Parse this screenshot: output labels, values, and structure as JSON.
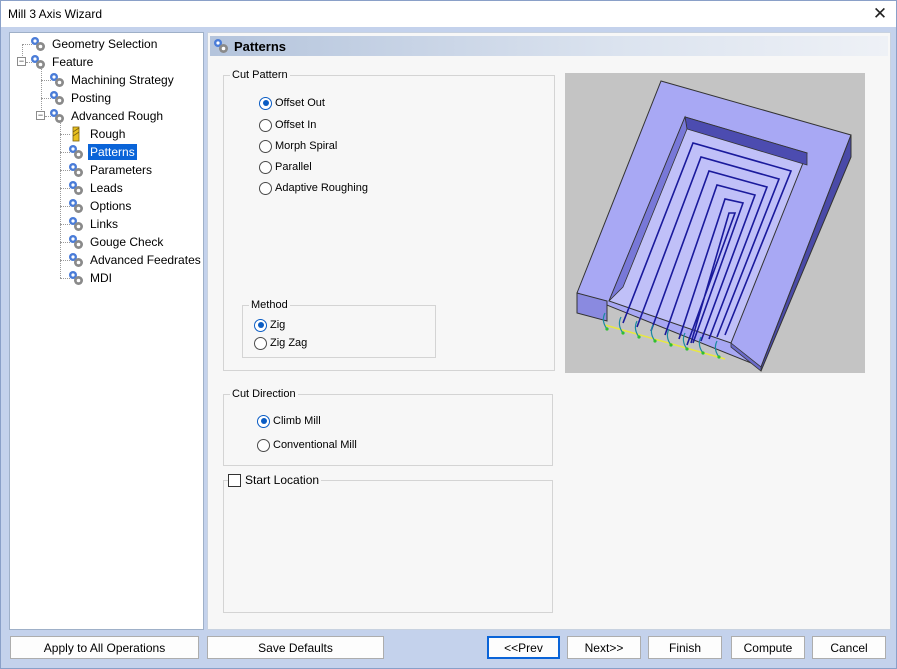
{
  "window": {
    "title": "Mill 3 Axis Wizard"
  },
  "tree": {
    "items": [
      {
        "label": "Geometry Selection",
        "icon": "gear-group-icon"
      },
      {
        "label": "Feature",
        "icon": "gear-group-icon"
      },
      {
        "label": "Machining Strategy",
        "icon": "gear-group-icon"
      },
      {
        "label": "Posting",
        "icon": "gear-group-icon"
      },
      {
        "label": "Advanced Rough",
        "icon": "gear-group-icon"
      },
      {
        "label": "Rough",
        "icon": "tool-icon"
      },
      {
        "label": "Patterns",
        "icon": "gear-group-icon",
        "selected": true
      },
      {
        "label": "Parameters",
        "icon": "gear-group-icon"
      },
      {
        "label": "Leads",
        "icon": "gear-group-icon"
      },
      {
        "label": "Options",
        "icon": "gear-group-icon"
      },
      {
        "label": "Links",
        "icon": "gear-group-icon"
      },
      {
        "label": "Gouge Check",
        "icon": "gear-group-icon"
      },
      {
        "label": "Advanced Feedrates",
        "icon": "gear-group-icon"
      },
      {
        "label": "MDI",
        "icon": "gear-group-icon"
      }
    ]
  },
  "panel": {
    "title": "Patterns",
    "cut_pattern": {
      "label": "Cut Pattern",
      "options": [
        "Offset Out",
        "Offset In",
        "Morph Spiral",
        "Parallel",
        "Adaptive Roughing"
      ],
      "selected": "Offset Out"
    },
    "method": {
      "label": "Method",
      "options": [
        "Zig",
        "Zig Zag"
      ],
      "selected": "Zig"
    },
    "cut_direction": {
      "label": "Cut Direction",
      "options": [
        "Climb Mill",
        "Conventional Mill"
      ],
      "selected": "Climb Mill"
    },
    "start_location": {
      "label": "Start Location",
      "checked": false
    }
  },
  "buttons": {
    "apply_all": "Apply to All Operations",
    "save_defaults": "Save Defaults",
    "prev": "<<Prev",
    "next": "Next>>",
    "finish": "Finish",
    "compute": "Compute",
    "cancel": "Cancel"
  },
  "colors": {
    "selection": "#0a64d8",
    "radio_accent": "#0a5cc4",
    "preview_bg": "#c4c4c4",
    "part_face": "#a8a8f4",
    "toolpath": "#1a1a9c"
  }
}
